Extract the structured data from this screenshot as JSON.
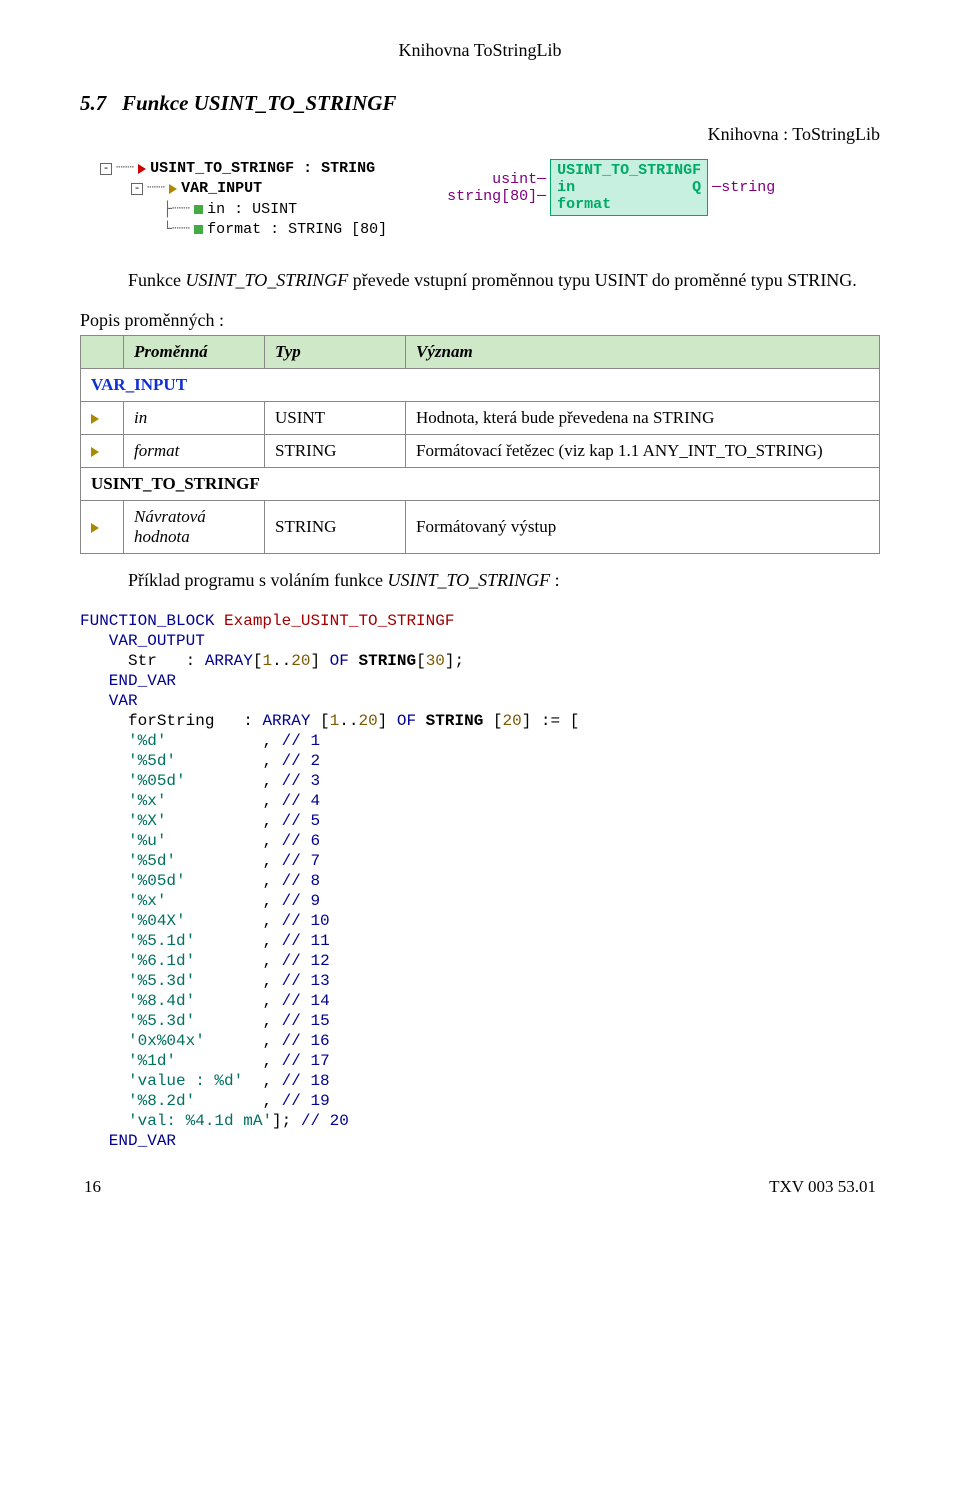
{
  "running_header": "Knihovna ToStringLib",
  "section_number": "5.7",
  "section_title": "Funkce USINT_TO_STRINGF",
  "library_label": "Knihovna : ToStringLib",
  "tree": {
    "fn_sig": "USINT_TO_STRINGF : STRING",
    "var_input": "VAR_INPUT",
    "in_decl": "in : USINT",
    "format_decl": "format : STRING [80]"
  },
  "fb": {
    "left_in": "usint",
    "left_format": "string[80]",
    "title": "USINT_TO_STRINGF",
    "port_in": "in",
    "port_q": "Q",
    "port_format": "format",
    "out_type": "string"
  },
  "para1_pre": "Funkce ",
  "para1_em": "USINT_TO_STRINGF",
  "para1_post": " převede vstupní proměnnou typu USINT do proměnné typu STRING.",
  "vars_caption": "Popis proměnných :",
  "table": {
    "h1": "Proměnná",
    "h2": "Typ",
    "h3": "Význam",
    "var_input": "VAR_INPUT",
    "r1_name": "in",
    "r1_type": "USINT",
    "r1_desc": "Hodnota, která bude převedena na STRING",
    "r2_name": "format",
    "r2_type": "STRING",
    "r2_desc": "Formátovací řetězec (viz kap 1.1 ANY_INT_TO_STRING)",
    "func_name": "USINT_TO_STRINGF",
    "r3_name": "Návratová hodnota",
    "r3_type": "STRING",
    "r3_desc": "Formátovaný výstup"
  },
  "para2_pre": "Příklad programu s voláním funkce ",
  "para2_em": "USINT_TO_STRINGF",
  "para2_post": " :",
  "code": {
    "l1a": "FUNCTION_BLOCK",
    "l1b": " Example_USINT_TO_STRINGF",
    "l2": "   VAR_OUTPUT",
    "l3a": "     Str   : ",
    "l3b": "ARRAY",
    "l3c": "[",
    "l3d": "1",
    "l3e": "..",
    "l3f": "20",
    "l3g": "] ",
    "l3h": "OF",
    "l3i": " STRING[",
    "l3j": "30",
    "l3k": "];",
    "l4": "   END_VAR",
    "l5": "   VAR",
    "l6a": "     forString   : ",
    "l6b": "ARRAY",
    "l6c": " [",
    "l6d": "1",
    "l6e": "..",
    "l6f": "20",
    "l6g": "] ",
    "l6h": "OF",
    "l6i": " STRING ",
    "l6j": "[",
    "l6k": "20",
    "l6l": "] := [",
    "rows": [
      {
        "s": "'%d'",
        "pad": "          ",
        "n": "1"
      },
      {
        "s": "'%5d'",
        "pad": "         ",
        "n": "2"
      },
      {
        "s": "'%05d'",
        "pad": "        ",
        "n": "3"
      },
      {
        "s": "'%x'",
        "pad": "          ",
        "n": "4"
      },
      {
        "s": "'%X'",
        "pad": "          ",
        "n": "5"
      },
      {
        "s": "'%u'",
        "pad": "          ",
        "n": "6"
      },
      {
        "s": "'%5d'",
        "pad": "         ",
        "n": "7"
      },
      {
        "s": "'%05d'",
        "pad": "        ",
        "n": "8"
      },
      {
        "s": "'%x'",
        "pad": "          ",
        "n": "9"
      },
      {
        "s": "'%04X'",
        "pad": "        ",
        "n": "10"
      },
      {
        "s": "'%5.1d'",
        "pad": "       ",
        "n": "11"
      },
      {
        "s": "'%6.1d'",
        "pad": "       ",
        "n": "12"
      },
      {
        "s": "'%5.3d'",
        "pad": "       ",
        "n": "13"
      },
      {
        "s": "'%8.4d'",
        "pad": "       ",
        "n": "14"
      },
      {
        "s": "'%5.3d'",
        "pad": "       ",
        "n": "15"
      },
      {
        "s": "'0x%04x'",
        "pad": "      ",
        "n": "16"
      },
      {
        "s": "'%1d'",
        "pad": "         ",
        "n": "17"
      },
      {
        "s": "'value : %d'",
        "pad": "  ",
        "n": "18"
      },
      {
        "s": "'%8.2d'",
        "pad": "       ",
        "n": "19"
      }
    ],
    "last_s": "'val: %4.1d mA'",
    "last_tail": "]; // ",
    "last_n": "20",
    "endvar": "   END_VAR"
  },
  "footer": {
    "page": "16",
    "docnum": "TXV 003 53.01"
  }
}
